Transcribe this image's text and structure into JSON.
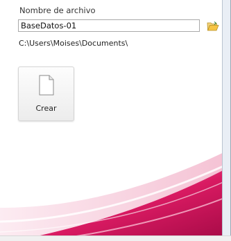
{
  "file": {
    "label": "Nombre de archivo",
    "name_value": "BaseDatos-01",
    "path": "C:\\Users\\Moises\\Documents\\"
  },
  "create_button": {
    "label": "Crear",
    "icon": "blank-document-icon"
  },
  "browse_button": {
    "icon": "open-folder-icon"
  },
  "colors": {
    "accent": "#d0145a",
    "accent_light": "#f3b6cc",
    "border": "#a9a9a9"
  }
}
